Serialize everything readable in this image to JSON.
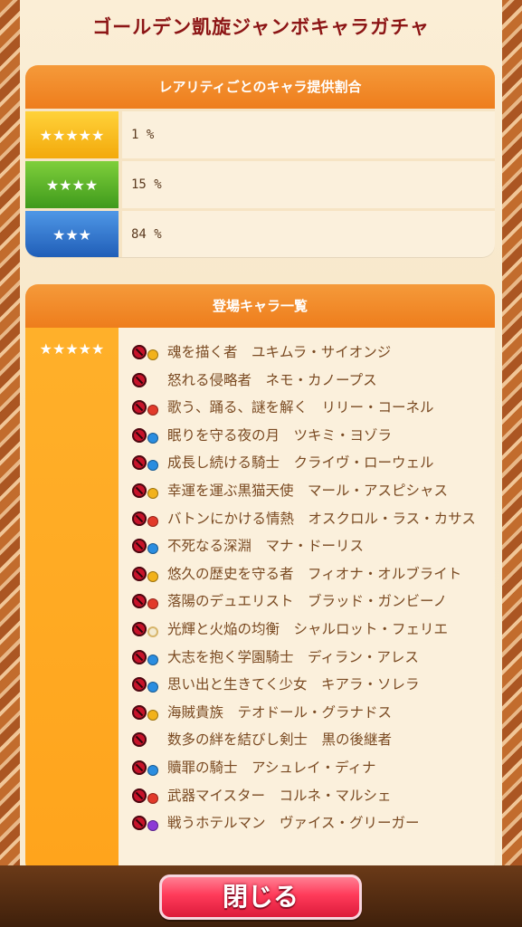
{
  "title": "ゴールデン凱旋ジャンボキャラガチャ",
  "rarity_section": {
    "header": "レアリティごとのキャラ提供割合",
    "rows": [
      {
        "stars": "★★★★★",
        "rate": "1 %"
      },
      {
        "stars": "★★★★",
        "rate": "15 %"
      },
      {
        "stars": "★★★",
        "rate": "84 %"
      }
    ]
  },
  "chara_section": {
    "header": "登場キャラ一覧",
    "left_stars": "★★★★★",
    "items": [
      {
        "attr": "thunder",
        "text": "魂を描く者　ユキムラ・サイオンジ"
      },
      {
        "attr": "none",
        "text": "怒れる侵略者　ネモ・カノープス"
      },
      {
        "attr": "fire",
        "text": "歌う、踊る、謎を解く　リリー・コーネル"
      },
      {
        "attr": "water",
        "text": "眠りを守る夜の月　ツキミ・ヨゾラ"
      },
      {
        "attr": "water",
        "text": "成長し続ける騎士　クライヴ・ローウェル"
      },
      {
        "attr": "thunder",
        "text": "幸運を運ぶ黒猫天使　マール・アスピシャス"
      },
      {
        "attr": "fire",
        "text": "バトンにかける情熱　オスクロル・ラス・カサス"
      },
      {
        "attr": "water",
        "text": "不死なる深淵　マナ・ドーリス"
      },
      {
        "attr": "thunder",
        "text": "悠久の歴史を守る者　フィオナ・オルブライト"
      },
      {
        "attr": "fire",
        "text": "落陽のデュエリスト　ブラッド・ガンビーノ"
      },
      {
        "attr": "light",
        "text": "光輝と火焔の均衡　シャルロット・フェリエ"
      },
      {
        "attr": "water",
        "text": "大志を抱く学園騎士　ディラン・アレス"
      },
      {
        "attr": "water",
        "text": "思い出と生きてく少女　キアラ・ソレラ"
      },
      {
        "attr": "thunder",
        "text": "海賊貴族　テオドール・グラナドス"
      },
      {
        "attr": "none",
        "text": "数多の絆を結びし剣士　黒の後継者"
      },
      {
        "attr": "water",
        "text": "贖罪の騎士　アシュレイ・ディナ"
      },
      {
        "attr": "fire",
        "text": "武器マイスター　コルネ・マルシェ"
      },
      {
        "attr": "dark",
        "text": "戦うホテルマン　ヴァイス・グリーガー"
      }
    ]
  },
  "close_button": "閉じる",
  "colors": {
    "title": "#8c1515",
    "header": "#ee7d1c",
    "star5": "#f3a90b",
    "star4": "#3f9a1c",
    "star3": "#1f5db7"
  }
}
